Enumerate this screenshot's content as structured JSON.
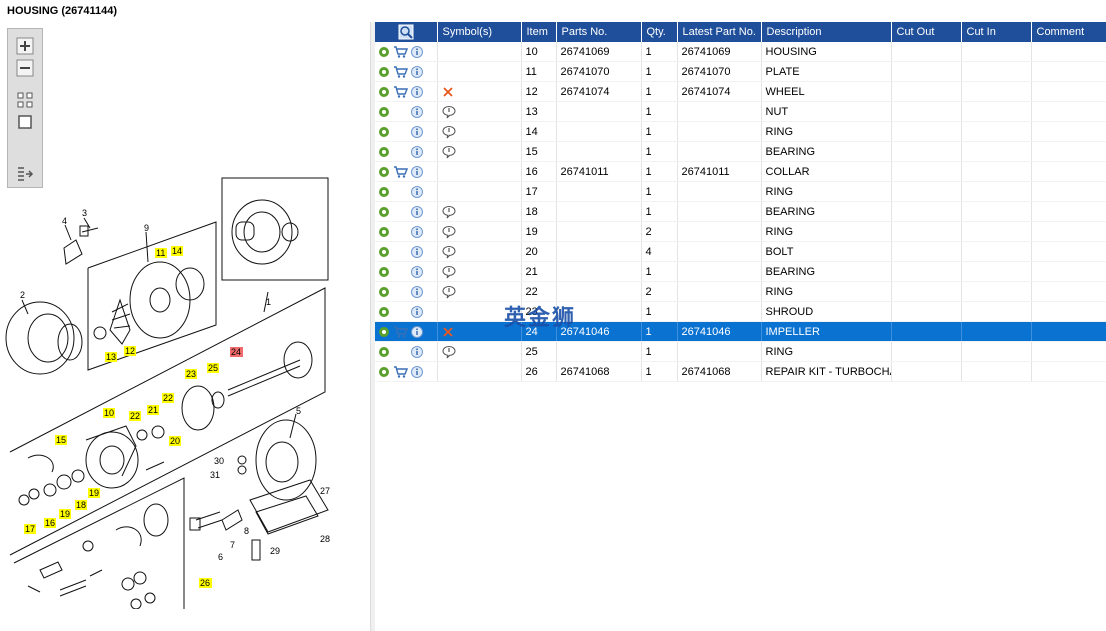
{
  "title": "HOUSING (26741144)",
  "watermark": "英金狮",
  "toolbar": {
    "buttons": [
      "zoom-in-icon",
      "zoom-out-icon",
      "fit-all-icon",
      "fit-window-icon",
      "export-icon"
    ]
  },
  "table": {
    "headers": [
      "",
      "Symbol(s)",
      "Item",
      "Parts No.",
      "Qty.",
      "Latest Part No.",
      "Description",
      "Cut Out",
      "Cut In",
      "Comment"
    ],
    "rows": [
      {
        "cart": true,
        "symbol": "",
        "item": "10",
        "part": "26741069",
        "qty": "1",
        "latest": "26741069",
        "desc": "HOUSING"
      },
      {
        "cart": true,
        "symbol": "",
        "item": "11",
        "part": "26741070",
        "qty": "1",
        "latest": "26741070",
        "desc": "PLATE"
      },
      {
        "cart": true,
        "symbol": "cross",
        "item": "12",
        "part": "26741074",
        "qty": "1",
        "latest": "26741074",
        "desc": "WHEEL"
      },
      {
        "cart": false,
        "symbol": "bubble",
        "item": "13",
        "part": "",
        "qty": "1",
        "latest": "",
        "desc": "NUT"
      },
      {
        "cart": false,
        "symbol": "bubble",
        "item": "14",
        "part": "",
        "qty": "1",
        "latest": "",
        "desc": "RING"
      },
      {
        "cart": false,
        "symbol": "bubble",
        "item": "15",
        "part": "",
        "qty": "1",
        "latest": "",
        "desc": "BEARING"
      },
      {
        "cart": true,
        "symbol": "",
        "item": "16",
        "part": "26741011",
        "qty": "1",
        "latest": "26741011",
        "desc": "COLLAR"
      },
      {
        "cart": false,
        "symbol": "",
        "item": "17",
        "part": "",
        "qty": "1",
        "latest": "",
        "desc": "RING"
      },
      {
        "cart": false,
        "symbol": "bubble",
        "item": "18",
        "part": "",
        "qty": "1",
        "latest": "",
        "desc": "BEARING"
      },
      {
        "cart": false,
        "symbol": "bubble",
        "item": "19",
        "part": "",
        "qty": "2",
        "latest": "",
        "desc": "RING"
      },
      {
        "cart": false,
        "symbol": "bubble",
        "item": "20",
        "part": "",
        "qty": "4",
        "latest": "",
        "desc": "BOLT"
      },
      {
        "cart": false,
        "symbol": "bubble",
        "item": "21",
        "part": "",
        "qty": "1",
        "latest": "",
        "desc": "BEARING"
      },
      {
        "cart": false,
        "symbol": "bubble",
        "item": "22",
        "part": "",
        "qty": "2",
        "latest": "",
        "desc": "RING"
      },
      {
        "cart": false,
        "symbol": "",
        "item": "23",
        "part": "",
        "qty": "1",
        "latest": "",
        "desc": "SHROUD"
      },
      {
        "cart": true,
        "symbol": "cross",
        "item": "24",
        "part": "26741046",
        "qty": "1",
        "latest": "26741046",
        "desc": "IMPELLER",
        "selected": true
      },
      {
        "cart": false,
        "symbol": "bubble",
        "item": "25",
        "part": "",
        "qty": "1",
        "latest": "",
        "desc": "RING"
      },
      {
        "cart": true,
        "symbol": "",
        "item": "26",
        "part": "26741068",
        "qty": "1",
        "latest": "26741068",
        "desc": "REPAIR KIT - TURBOCHAR"
      }
    ]
  },
  "callouts": {
    "c1": "1",
    "c2": "2",
    "c3": "3",
    "c4": "4",
    "c5": "5",
    "c6": "6",
    "c7": "7",
    "c8": "8",
    "c9": "9",
    "c10": "10",
    "c11": "11",
    "c12": "12",
    "c13": "13",
    "c14": "14",
    "c15": "15",
    "c16": "16",
    "c17": "17",
    "c18": "18",
    "c19a": "19",
    "c19b": "19",
    "c20": "20",
    "c21": "21",
    "c22a": "22",
    "c22b": "22",
    "c23": "23",
    "c24": "24",
    "c25": "25",
    "c26": "26",
    "c27": "27",
    "c28": "28",
    "c29": "29",
    "c30": "30",
    "c31": "31"
  },
  "colors": {
    "header": "#1f4e9a",
    "selected": "#0a72d1",
    "highlight": "#ffff00",
    "red_highlight": "#f06b6b"
  }
}
